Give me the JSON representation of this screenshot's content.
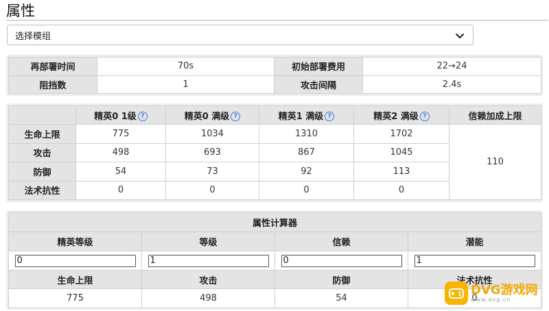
{
  "page": {
    "title": "属性"
  },
  "module_select": {
    "placeholder": "选择模组"
  },
  "info": {
    "redeploy_label": "再部署时间",
    "redeploy_value": "70s",
    "cost_label": "初始部署费用",
    "cost_value": "22→24",
    "block_label": "阻挡数",
    "block_value": "1",
    "interval_label": "攻击间隔",
    "interval_value": "2.4s"
  },
  "stats": {
    "columns": [
      "精英0 1级",
      "精英0 满级",
      "精英1 满级",
      "精英2 满级",
      "信赖加成上限"
    ],
    "rows": [
      {
        "label": "生命上限",
        "values": [
          "775",
          "1034",
          "1310",
          "1702"
        ]
      },
      {
        "label": "攻击",
        "values": [
          "498",
          "693",
          "867",
          "1045"
        ]
      },
      {
        "label": "防御",
        "values": [
          "54",
          "73",
          "92",
          "113"
        ]
      },
      {
        "label": "法术抗性",
        "values": [
          "0",
          "0",
          "0",
          "0"
        ]
      }
    ],
    "trust_bonus": "110"
  },
  "calculator": {
    "title": "属性计算器",
    "inputs": [
      {
        "label": "精英等级",
        "value": "0"
      },
      {
        "label": "等级",
        "value": "1"
      },
      {
        "label": "信赖",
        "value": "0"
      },
      {
        "label": "潜能",
        "value": "1"
      }
    ],
    "outputs": [
      {
        "label": "生命上限",
        "value": "775"
      },
      {
        "label": "攻击",
        "value": "498"
      },
      {
        "label": "防御",
        "value": "54"
      },
      {
        "label": "法术抗性",
        "value": "0"
      }
    ]
  },
  "watermark": {
    "text": "DVG游戏网",
    "sub": "www.dvg.cn"
  },
  "colors": {
    "header_bg": "#e4e4e4",
    "panel_bg": "#ededed",
    "accent": "#3a7bd5",
    "watermark": "#f7b500"
  },
  "icons": {
    "chevron": "chevron-down-icon",
    "help": "help-circle-icon"
  }
}
